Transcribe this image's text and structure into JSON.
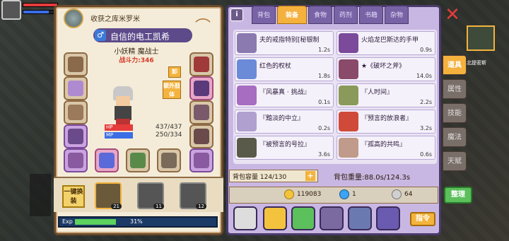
{
  "hud": {
    "hp_tag": "HP",
    "mp_tag": "MP"
  },
  "equipment": {
    "guild": "收获之库米罗米",
    "name": "自信的电工凯希",
    "class": "小妖精 魔战士",
    "power": "战斗力:346",
    "hp_label": "HP",
    "hp_value": "437/437",
    "mp_label": "MP",
    "mp_value": "250/334",
    "unload_label": "卸",
    "extra_limb_label": "额外肢体",
    "exp_label": "Exp",
    "exp_pct": "31%",
    "team_button": "一键换装",
    "team": [
      {
        "level": "21"
      },
      {
        "level": "11"
      },
      {
        "level": "12"
      }
    ]
  },
  "inventory": {
    "info_label": "i",
    "tabs": [
      "背包",
      "装备",
      "食物",
      "药剂",
      "书籍",
      "杂物"
    ],
    "active_tab": "装备",
    "items": [
      {
        "name": "夫的戒指特别[秘银制",
        "time": "1.2s",
        "color": "#8a7ab0"
      },
      {
        "name": "火焰龙巴斯达的手甲",
        "time": "0.9s",
        "color": "#7b4a9a"
      },
      {
        "name": "红色的权杖",
        "time": "1.8s",
        "color": "#6b8ad8"
      },
      {
        "name": "★《破坏之斧》",
        "time": "14.0s",
        "color": "#8a4a6a"
      },
      {
        "name": "『风暴真 · 挑战』",
        "time": "0.1s",
        "color": "#a66dc0"
      },
      {
        "name": "『人时间』",
        "time": "2.2s",
        "color": "#8a9a5a"
      },
      {
        "name": "『黯淡的中立』",
        "time": "0.2s",
        "color": "#b0a0d0"
      },
      {
        "name": "『预言的放浪者』",
        "time": "3.2s",
        "color": "#d04a3a"
      },
      {
        "name": "『被预言的号拉』",
        "time": "3.6s",
        "color": "#5a5a4a"
      },
      {
        "name": "『孤高的共鸣』",
        "time": "0.6s",
        "color": "#c09a8a"
      }
    ],
    "capacity_label": "背包容量 124/130",
    "weight_label": "背包重量:88.0s/124.3s",
    "gold": "119083",
    "gems": "1",
    "silver": "64",
    "command_label": "指令",
    "sort_label": "整理"
  },
  "side_tabs": [
    "道具",
    "属性",
    "技能",
    "魔法",
    "天赋"
  ],
  "active_side_tab": "道具",
  "location": "北提密斯"
}
